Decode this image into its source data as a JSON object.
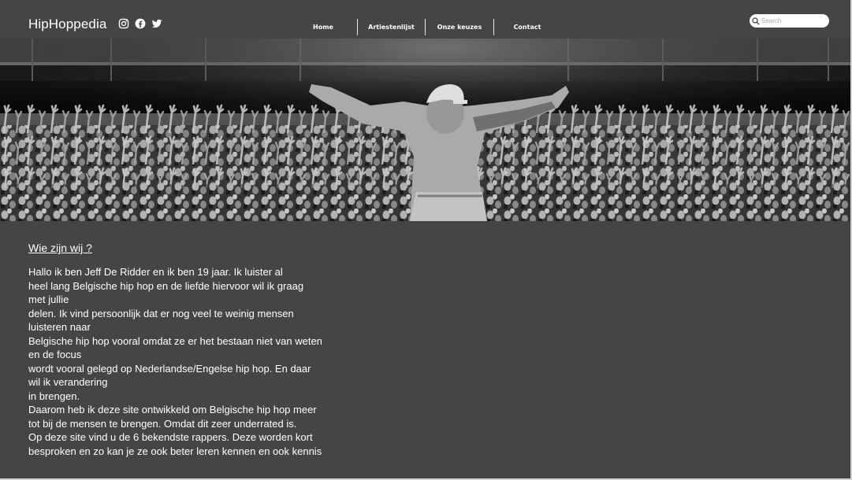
{
  "header": {
    "brand": "HipHoppedia",
    "social": [
      "instagram-icon",
      "facebook-icon",
      "twitter-icon"
    ],
    "nav": {
      "home": "Home",
      "artists": "Artiestenlijst",
      "choices": "Onze keuzes",
      "contact": "Contact"
    },
    "search": {
      "placeholder": "Search",
      "value": ""
    }
  },
  "hero": {
    "image": "black-and-white concert photo",
    "colors": {
      "dark": "#0f0f0f",
      "mid": "#6a6a6a",
      "light": "#e8e8e8"
    }
  },
  "about": {
    "heading": "Wie zijn wij ?",
    "lines": [
      "Hallo ik ben Jeff De Ridder en ik ben 19 jaar. Ik luister al",
      "heel lang Belgische hip hop en de liefde hiervoor wil ik graag",
      "met jullie",
      "delen. Ik vind persoonlijk dat er nog veel te weinig mensen",
      "luisteren naar",
      "Belgische hip hop vooral omdat ze er het bestaan niet van weten",
      "en de focus",
      "wordt vooral gelegd op Nederlandse/Engelse hip hop. En daar",
      "wil ik verandering",
      "in brengen.",
      "Daarom heb ik deze site ontwikkeld om Belgische hip hop meer",
      "tot bij de mensen te brengen. Omdat dit zeer underrated is.",
      "Op deze site vind u de 6 bekendste rappers. Deze worden kort",
      "besproken en zo kan je ze ook beter leren kennen en ook kennis"
    ]
  },
  "colors": {
    "background": "#454545",
    "text": "#ffffff",
    "separator": "#e6e6e6"
  }
}
